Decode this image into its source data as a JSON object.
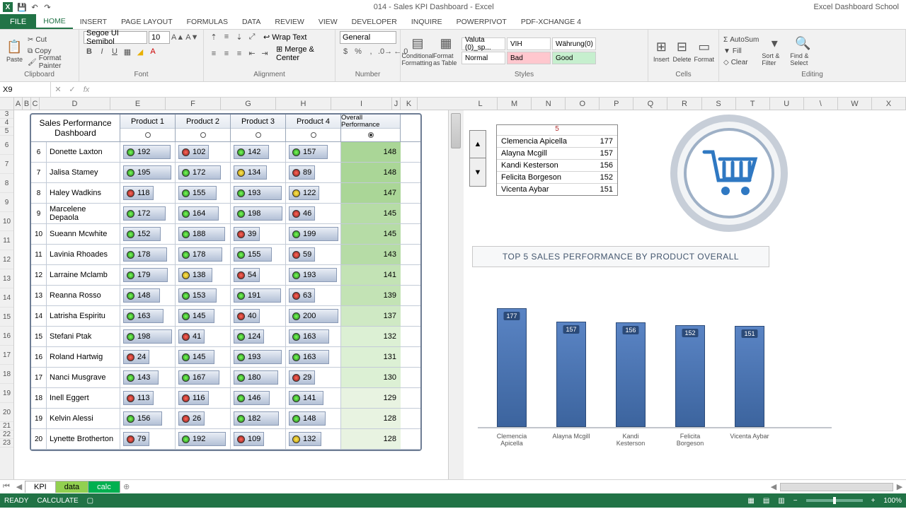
{
  "app": {
    "title": "014 - Sales KPI Dashboard - Excel",
    "credit": "Excel Dashboard School"
  },
  "ribbon": {
    "tabs": [
      "FILE",
      "HOME",
      "INSERT",
      "PAGE LAYOUT",
      "FORMULAS",
      "DATA",
      "REVIEW",
      "VIEW",
      "DEVELOPER",
      "INQUIRE",
      "POWERPIVOT",
      "PDF-XChange 4"
    ],
    "active": "HOME",
    "font_name": "Segoe UI Semibol",
    "font_size": "10",
    "number_format": "General",
    "groups": {
      "clipboard": "Clipboard",
      "font": "Font",
      "alignment": "Alignment",
      "number": "Number",
      "styles": "Styles",
      "cells": "Cells",
      "editing": "Editing"
    },
    "clipboard": {
      "paste": "Paste",
      "cut": "Cut",
      "copy": "Copy",
      "fp": "Format Painter"
    },
    "align": {
      "wrap": "Wrap Text",
      "merge": "Merge & Center"
    },
    "cond": "Conditional Formatting",
    "fmtas": "Format as Table",
    "style_header": {
      "a": "Valuta (0)_sp...",
      "b": "VIH",
      "c": "Währung(0)"
    },
    "style_normal": "Normal",
    "style_bad": "Bad",
    "style_good": "Good",
    "cells": {
      "insert": "Insert",
      "delete": "Delete",
      "format": "Format"
    },
    "edit": {
      "autosum": "AutoSum",
      "fill": "Fill",
      "clear": "Clear",
      "sort": "Sort & Filter",
      "find": "Find & Select"
    }
  },
  "namebox": "X9",
  "dashboard": {
    "title": "Sales Performance Dashboard",
    "headers": [
      "Product 1",
      "Product 2",
      "Product 3",
      "Product 4",
      "Overall Performance"
    ],
    "selected": 4,
    "rows": [
      {
        "n": 6,
        "name": "Donette Laxton",
        "p": [
          [
            192,
            "g"
          ],
          [
            102,
            "r"
          ],
          [
            142,
            "g"
          ],
          [
            157,
            "g"
          ]
        ],
        "o": 148,
        "sh": 5
      },
      {
        "n": 7,
        "name": "Jalisa Stamey",
        "p": [
          [
            195,
            "g"
          ],
          [
            172,
            "g"
          ],
          [
            134,
            "y"
          ],
          [
            89,
            "r"
          ]
        ],
        "o": 148,
        "sh": 5
      },
      {
        "n": 8,
        "name": "Haley Wadkins",
        "p": [
          [
            118,
            "r"
          ],
          [
            155,
            "g"
          ],
          [
            193,
            "g"
          ],
          [
            122,
            "y"
          ]
        ],
        "o": 147,
        "sh": 5
      },
      {
        "n": 9,
        "name": "Marcelene Depaola",
        "p": [
          [
            172,
            "g"
          ],
          [
            164,
            "g"
          ],
          [
            198,
            "g"
          ],
          [
            46,
            "r"
          ]
        ],
        "o": 145,
        "sh": 4
      },
      {
        "n": 10,
        "name": "Sueann Mcwhite",
        "p": [
          [
            152,
            "g"
          ],
          [
            188,
            "g"
          ],
          [
            39,
            "r"
          ],
          [
            199,
            "g"
          ]
        ],
        "o": 145,
        "sh": 4
      },
      {
        "n": 11,
        "name": "Lavinia Rhoades",
        "p": [
          [
            178,
            "g"
          ],
          [
            178,
            "g"
          ],
          [
            155,
            "g"
          ],
          [
            59,
            "r"
          ]
        ],
        "o": 143,
        "sh": 4
      },
      {
        "n": 12,
        "name": "Larraine Mclamb",
        "p": [
          [
            179,
            "g"
          ],
          [
            138,
            "y"
          ],
          [
            54,
            "r"
          ],
          [
            193,
            "g"
          ]
        ],
        "o": 141,
        "sh": 3
      },
      {
        "n": 13,
        "name": "Reanna Rosso",
        "p": [
          [
            148,
            "g"
          ],
          [
            153,
            "g"
          ],
          [
            191,
            "g"
          ],
          [
            63,
            "r"
          ]
        ],
        "o": 139,
        "sh": 3
      },
      {
        "n": 14,
        "name": "Latrisha Espiritu",
        "p": [
          [
            163,
            "g"
          ],
          [
            145,
            "g"
          ],
          [
            40,
            "r"
          ],
          [
            200,
            "g"
          ]
        ],
        "o": 137,
        "sh": 2
      },
      {
        "n": 15,
        "name": "Stefani Ptak",
        "p": [
          [
            198,
            "g"
          ],
          [
            41,
            "r"
          ],
          [
            124,
            "g"
          ],
          [
            163,
            "g"
          ]
        ],
        "o": 132,
        "sh": 1
      },
      {
        "n": 16,
        "name": "Roland Hartwig",
        "p": [
          [
            24,
            "r"
          ],
          [
            145,
            "g"
          ],
          [
            193,
            "g"
          ],
          [
            163,
            "g"
          ]
        ],
        "o": 131,
        "sh": 1
      },
      {
        "n": 17,
        "name": "Nanci Musgrave",
        "p": [
          [
            143,
            "g"
          ],
          [
            167,
            "g"
          ],
          [
            180,
            "g"
          ],
          [
            29,
            "r"
          ]
        ],
        "o": 130,
        "sh": 1
      },
      {
        "n": 18,
        "name": "Inell Eggert",
        "p": [
          [
            113,
            "r"
          ],
          [
            116,
            "r"
          ],
          [
            146,
            "g"
          ],
          [
            141,
            "g"
          ]
        ],
        "o": 129,
        "sh": 0
      },
      {
        "n": 19,
        "name": "Kelvin Alessi",
        "p": [
          [
            156,
            "g"
          ],
          [
            26,
            "r"
          ],
          [
            182,
            "g"
          ],
          [
            148,
            "g"
          ]
        ],
        "o": 128,
        "sh": 0
      },
      {
        "n": 20,
        "name": "Lynette Brotherton",
        "p": [
          [
            79,
            "r"
          ],
          [
            192,
            "g"
          ],
          [
            109,
            "r"
          ],
          [
            132,
            "y"
          ]
        ],
        "o": 128,
        "sh": 0
      }
    ],
    "shades": [
      "#e8f3e1",
      "#dcf0d4",
      "#cfe9c4",
      "#c3e3b5",
      "#b6dca6",
      "#aad697"
    ]
  },
  "top5": {
    "caption": "5",
    "rows": [
      {
        "name": "Clemencia Apicella",
        "v": 177
      },
      {
        "name": "Alayna Mcgill",
        "v": 157
      },
      {
        "name": "Kandi Kesterson",
        "v": 156
      },
      {
        "name": "Felicita Borgeson",
        "v": 152
      },
      {
        "name": "Vicenta Aybar",
        "v": 151
      }
    ]
  },
  "chart_data": {
    "type": "bar",
    "title": "TOP 5 SALES PERFORMANCE BY PRODUCT OVERALL",
    "categories": [
      "Clemencia Apicella",
      "Alayna Mcgill",
      "Kandi Kesterson",
      "Felicita Borgeson",
      "Vicenta Aybar"
    ],
    "values": [
      177,
      157,
      156,
      152,
      151
    ],
    "ylim": [
      0,
      200
    ],
    "xlabel": "",
    "ylabel": ""
  },
  "columns_left": [
    "",
    "A",
    "B",
    "C",
    "D",
    "E",
    "F",
    "G",
    "H",
    "I",
    "J",
    "K"
  ],
  "columns_right": [
    "L",
    "M",
    "N",
    "O",
    "P",
    "Q",
    "R",
    "S",
    "T",
    "U",
    "\\",
    "W",
    "X"
  ],
  "sheets": {
    "names": [
      "KPI",
      "data",
      "calc"
    ],
    "active": 0
  },
  "status": {
    "ready": "READY",
    "calc": "CALCULATE",
    "zoom": "100%"
  }
}
